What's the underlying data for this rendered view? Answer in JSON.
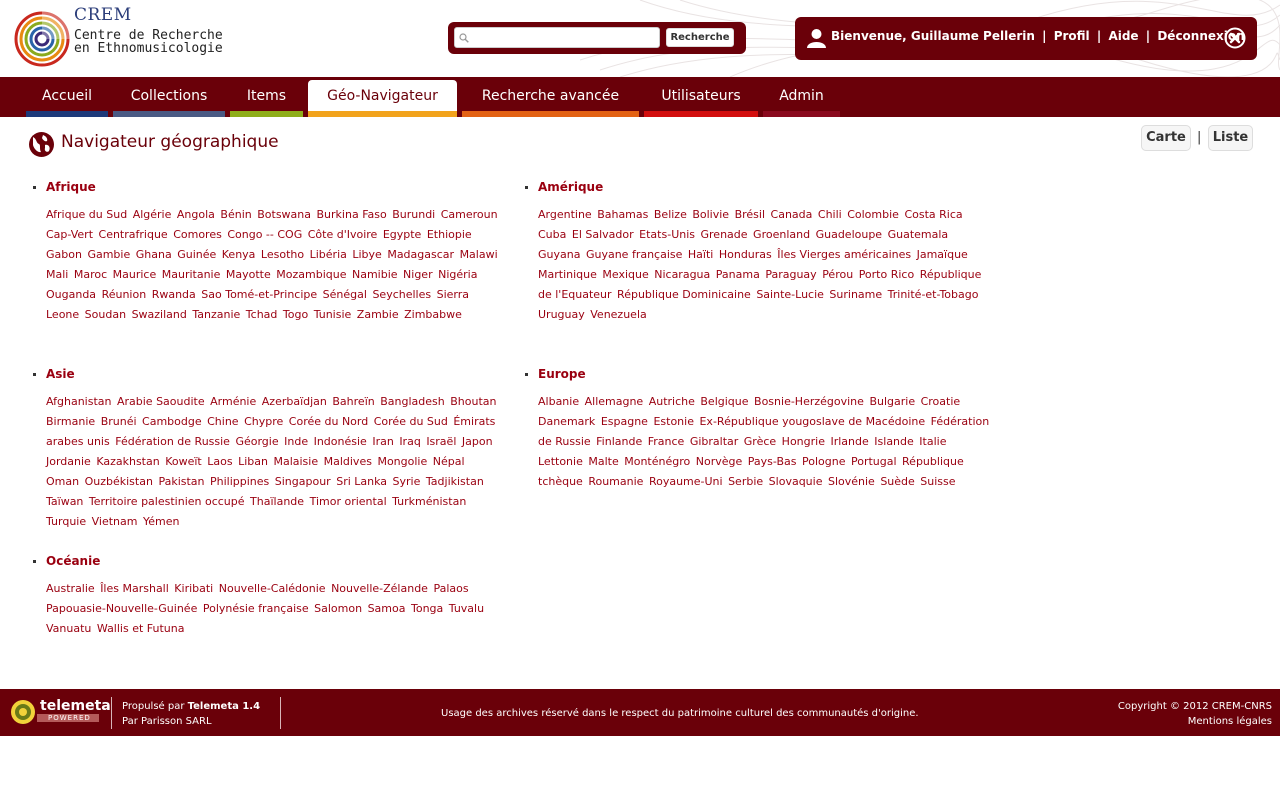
{
  "header": {
    "logo": {
      "acronym": "CREM",
      "line1": "Centre de Recherche",
      "line2": "en Ethnomusicologie"
    },
    "search": {
      "placeholder": "",
      "button_label": "Recherche"
    },
    "user": {
      "greeting": "Bienvenue, Guillaume Pellerin",
      "profile": "Profil",
      "help": "Aide",
      "logout": "Déconnexion",
      "separator": "|"
    }
  },
  "nav": {
    "tabs": [
      {
        "label": "Accueil",
        "color": "#1d3a7a"
      },
      {
        "label": "Collections",
        "color": "#4a5a84"
      },
      {
        "label": "Items",
        "color": "#8fae1b"
      },
      {
        "label": "Géo-Navigateur",
        "color": "#f2a31c",
        "active": true
      },
      {
        "label": "Recherche avancée",
        "color": "#e36214"
      },
      {
        "label": "Utilisateurs",
        "color": "#d30e0e"
      },
      {
        "label": "Admin",
        "color": "#8a0a1e"
      }
    ]
  },
  "page": {
    "title": "Navigateur géographique",
    "view_map": "Carte",
    "view_list": "Liste",
    "view_sep": "|"
  },
  "continents": [
    {
      "name": "Afrique",
      "countries": [
        "Afrique du Sud",
        "Algérie",
        "Angola",
        "Bénin",
        "Botswana",
        "Burkina Faso",
        "Burundi",
        "Cameroun",
        "Cap-Vert",
        "Centrafrique",
        "Comores",
        "Congo -- COG",
        "Côte d'Ivoire",
        "Egypte",
        "Ethiopie",
        "Gabon",
        "Gambie",
        "Ghana",
        "Guinée",
        "Kenya",
        "Lesotho",
        "Libéria",
        "Libye",
        "Madagascar",
        "Malawi",
        "Mali",
        "Maroc",
        "Maurice",
        "Mauritanie",
        "Mayotte",
        "Mozambique",
        "Namibie",
        "Niger",
        "Nigéria",
        "Ouganda",
        "Réunion",
        "Rwanda",
        "Sao Tomé-et-Principe",
        "Sénégal",
        "Seychelles",
        "Sierra Leone",
        "Soudan",
        "Swaziland",
        "Tanzanie",
        "Tchad",
        "Togo",
        "Tunisie",
        "Zambie",
        "Zimbabwe"
      ]
    },
    {
      "name": "Amérique",
      "countries": [
        "Argentine",
        "Bahamas",
        "Belize",
        "Bolivie",
        "Brésil",
        "Canada",
        "Chili",
        "Colombie",
        "Costa Rica",
        "Cuba",
        "El Salvador",
        "Etats-Unis",
        "Grenade",
        "Groenland",
        "Guadeloupe",
        "Guatemala",
        "Guyana",
        "Guyane française",
        "Haïti",
        "Honduras",
        "Îles Vierges américaines",
        "Jamaïque",
        "Martinique",
        "Mexique",
        "Nicaragua",
        "Panama",
        "Paraguay",
        "Pérou",
        "Porto Rico",
        "République de l'Equateur",
        "République Dominicaine",
        "Sainte-Lucie",
        "Suriname",
        "Trinité-et-Tobago",
        "Uruguay",
        "Venezuela"
      ]
    },
    {
      "name": "Asie",
      "countries": [
        "Afghanistan",
        "Arabie Saoudite",
        "Arménie",
        "Azerbaïdjan",
        "Bahreïn",
        "Bangladesh",
        "Bhoutan",
        "Birmanie",
        "Brunéi",
        "Cambodge",
        "Chine",
        "Chypre",
        "Corée du Nord",
        "Corée du Sud",
        "Émirats arabes unis",
        "Fédération de Russie",
        "Géorgie",
        "Inde",
        "Indonésie",
        "Iran",
        "Iraq",
        "Israël",
        "Japon",
        "Jordanie",
        "Kazakhstan",
        "Koweït",
        "Laos",
        "Liban",
        "Malaisie",
        "Maldives",
        "Mongolie",
        "Népal",
        "Oman",
        "Ouzbékistan",
        "Pakistan",
        "Philippines",
        "Singapour",
        "Sri Lanka",
        "Syrie",
        "Tadjikistan",
        "Taïwan",
        "Territoire palestinien occupé",
        "Thaïlande",
        "Timor oriental",
        "Turkménistan",
        "Turquie",
        "Vietnam",
        "Yémen"
      ]
    },
    {
      "name": "Europe",
      "countries": [
        "Albanie",
        "Allemagne",
        "Autriche",
        "Belgique",
        "Bosnie-Herzégovine",
        "Bulgarie",
        "Croatie",
        "Danemark",
        "Espagne",
        "Estonie",
        "Ex-République yougoslave de Macédoine",
        "Fédération de Russie",
        "Finlande",
        "France",
        "Gibraltar",
        "Grèce",
        "Hongrie",
        "Irlande",
        "Islande",
        "Italie",
        "Lettonie",
        "Malte",
        "Monténégro",
        "Norvège",
        "Pays-Bas",
        "Pologne",
        "Portugal",
        "République tchèque",
        "Roumanie",
        "Royaume-Uni",
        "Serbie",
        "Slovaquie",
        "Slovénie",
        "Suède",
        "Suisse"
      ]
    },
    {
      "name": "Océanie",
      "countries": [
        "Australie",
        "Îles Marshall",
        "Kiribati",
        "Nouvelle-Calédonie",
        "Nouvelle-Zélande",
        "Palaos",
        "Papouasie-Nouvelle-Guinée",
        "Polynésie française",
        "Salomon",
        "Samoa",
        "Tonga",
        "Tuvalu",
        "Vanuatu",
        "Wallis et Futuna"
      ]
    }
  ],
  "footer": {
    "logo_word": "telemeta",
    "logo_sub": "POWERED",
    "powered_prefix": "Propulsé par",
    "powered_name": "Telemeta 1.4",
    "by": "Par Parisson SARL",
    "usage": "Usage des archives réservé dans le respect du patrimoine culturel des communautés d'origine.",
    "copyright": "Copyright © 2012 CREM-CNRS",
    "legal": "Mentions légales"
  }
}
